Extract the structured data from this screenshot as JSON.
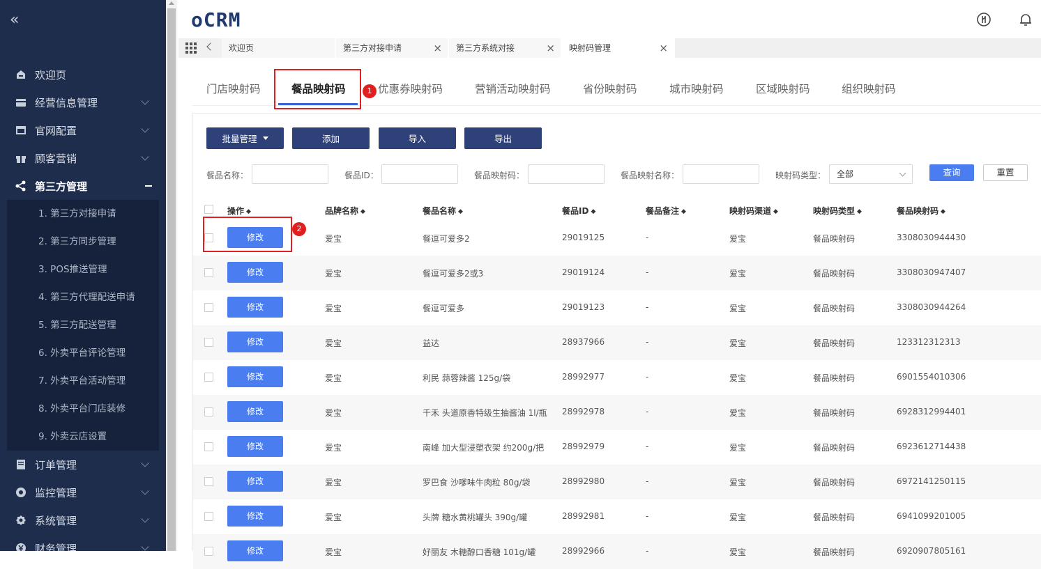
{
  "sidebar": {
    "collapse_icon": "«",
    "items": [
      {
        "label": "欢迎页",
        "icon": "home-icon"
      },
      {
        "label": "经营信息管理",
        "icon": "card-icon"
      },
      {
        "label": "官网配置",
        "icon": "window-icon"
      },
      {
        "label": "顾客营销",
        "icon": "gift-icon"
      },
      {
        "label": "第三方管理",
        "icon": "share-icon"
      },
      {
        "label": "订单管理",
        "icon": "doc-icon"
      },
      {
        "label": "监控管理",
        "icon": "monitor-icon"
      },
      {
        "label": "系统管理",
        "icon": "gear-icon"
      },
      {
        "label": "财务管理",
        "icon": "money-icon"
      }
    ],
    "subitems": [
      "1. 第三方对接申请",
      "2. 第三方同步管理",
      "3. POS推送管理",
      "4. 第三方代理配送申请",
      "5. 第三方配送管理",
      "6. 外卖平台评论管理",
      "7. 外卖平台活动管理",
      "8. 外卖平台门店装修",
      "9. 外卖云店设置"
    ]
  },
  "header": {
    "logo": "oCRM"
  },
  "tabs": [
    {
      "label": "欢迎页"
    },
    {
      "label": "第三方对接申请"
    },
    {
      "label": "第三方系统对接"
    },
    {
      "label": "映射码管理"
    }
  ],
  "tab_close": "×",
  "categories": [
    "门店映射码",
    "餐品映射码",
    "优惠券映射码",
    "营销活动映射码",
    "省份映射码",
    "城市映射码",
    "区域映射码",
    "组织映射码"
  ],
  "annotations": {
    "badge1": "1",
    "badge2": "2"
  },
  "toolbar": {
    "batch": "批量管理",
    "add": "添加",
    "import": "导入",
    "export": "导出"
  },
  "filters": {
    "dish_name": "餐品名称：",
    "dish_id": "餐品ID：",
    "dish_code": "餐品映射码：",
    "dish_code_name": "餐品映射名称：",
    "code_type": "映射码类型：",
    "code_type_value": "全部",
    "query": "查询",
    "reset": "重置"
  },
  "table": {
    "columns": [
      "操作",
      "品牌名称",
      "餐品名称",
      "餐品ID",
      "餐品备注",
      "映射码渠道",
      "映射码类型",
      "餐品映射码"
    ],
    "edit_label": "修改",
    "sort_icon": "◆",
    "rows": [
      {
        "brand": "爱宝",
        "name": "餐逗可爱多2",
        "id": "29019125",
        "note": "-",
        "channel": "爱宝",
        "type": "餐品映射码",
        "code": "3308030944430"
      },
      {
        "brand": "爱宝",
        "name": "餐逗可爱多2或3",
        "id": "29019124",
        "note": "-",
        "channel": "爱宝",
        "type": "餐品映射码",
        "code": "3308030947407"
      },
      {
        "brand": "爱宝",
        "name": "餐逗可爱多",
        "id": "29019123",
        "note": "-",
        "channel": "爱宝",
        "type": "餐品映射码",
        "code": "3308030944264"
      },
      {
        "brand": "爱宝",
        "name": "益达",
        "id": "28937966",
        "note": "-",
        "channel": "爱宝",
        "type": "餐品映射码",
        "code": "123312312313"
      },
      {
        "brand": "爱宝",
        "name": "利民 蒜蓉辣酱 125g/袋",
        "id": "28992977",
        "note": "-",
        "channel": "爱宝",
        "type": "餐品映射码",
        "code": "6901554010306"
      },
      {
        "brand": "爱宝",
        "name": "千禾 头道原香特级生抽酱油 1l/瓶",
        "id": "28992978",
        "note": "-",
        "channel": "爱宝",
        "type": "餐品映射码",
        "code": "6928312994401"
      },
      {
        "brand": "爱宝",
        "name": "南峰 加大型浸塑衣架 约200g/把",
        "id": "28992979",
        "note": "-",
        "channel": "爱宝",
        "type": "餐品映射码",
        "code": "6923612714438"
      },
      {
        "brand": "爱宝",
        "name": "罗巴食 沙嗲味牛肉粒 80g/袋",
        "id": "28992980",
        "note": "-",
        "channel": "爱宝",
        "type": "餐品映射码",
        "code": "6972141250115"
      },
      {
        "brand": "爱宝",
        "name": "头牌 糖水黄桃罐头 390g/罐",
        "id": "28992981",
        "note": "-",
        "channel": "爱宝",
        "type": "餐品映射码",
        "code": "6941099201005"
      },
      {
        "brand": "爱宝",
        "name": "好丽友 木糖醇口香糖 101g/罐",
        "id": "28992966",
        "note": "-",
        "channel": "爱宝",
        "type": "餐品映射码",
        "code": "6920907805161"
      }
    ]
  }
}
